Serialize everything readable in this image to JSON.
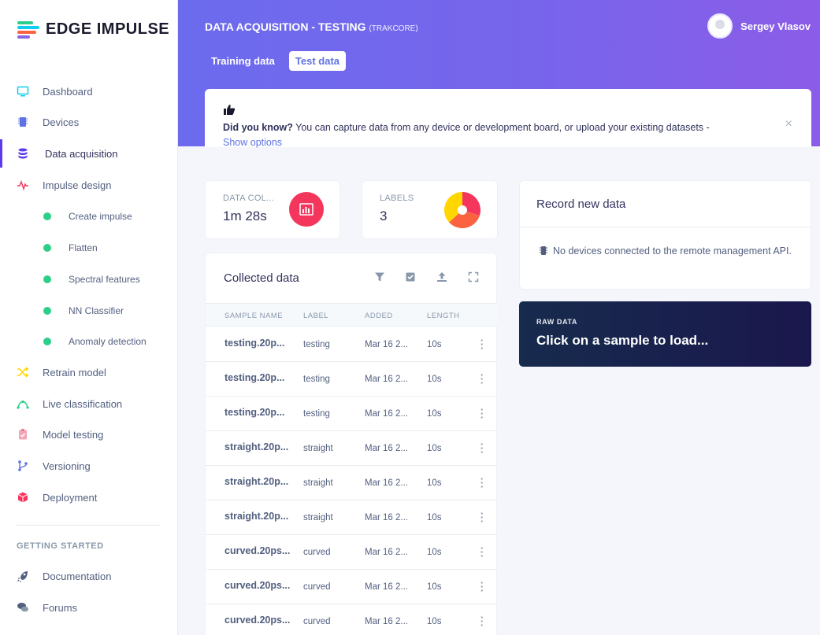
{
  "app": {
    "logo_text": "EDGE IMPULSE"
  },
  "sidebar": {
    "items": [
      {
        "label": "Dashboard",
        "icon": "monitor-icon"
      },
      {
        "label": "Devices",
        "icon": "chip-icon"
      },
      {
        "label": "Data acquisition",
        "icon": "database-icon",
        "active": true
      },
      {
        "label": "Impulse design",
        "icon": "pulse-icon"
      }
    ],
    "subitems": [
      {
        "label": "Create impulse"
      },
      {
        "label": "Flatten"
      },
      {
        "label": "Spectral features"
      },
      {
        "label": "NN Classifier"
      },
      {
        "label": "Anomaly detection"
      }
    ],
    "items2": [
      {
        "label": "Retrain model",
        "icon": "shuffle-icon"
      },
      {
        "label": "Live classification",
        "icon": "signal-icon"
      },
      {
        "label": "Model testing",
        "icon": "clipboard-check-icon"
      },
      {
        "label": "Versioning",
        "icon": "git-branch-icon"
      },
      {
        "label": "Deployment",
        "icon": "package-icon"
      }
    ],
    "getting_started_heading": "GETTING STARTED",
    "help_items": [
      {
        "label": "Documentation",
        "icon": "rocket-icon"
      },
      {
        "label": "Forums",
        "icon": "chat-icon"
      }
    ]
  },
  "header": {
    "title": "DATA ACQUISITION - TESTING",
    "project": "(TRAKCORE)",
    "user_name": "Sergey Vlasov",
    "tabs": [
      {
        "label": "Training data",
        "active": false
      },
      {
        "label": "Test data",
        "active": true
      }
    ]
  },
  "info": {
    "bold": "Did you know?",
    "text": " You can capture data from any device or development board, or upload your existing datasets -",
    "link": "Show options",
    "close": "×"
  },
  "stats": {
    "data_collected_label": "DATA COL...",
    "data_collected_value": "1m 28s",
    "labels_label": "LABELS",
    "labels_value": "3"
  },
  "collected": {
    "title": "Collected data",
    "columns": [
      "SAMPLE NAME",
      "LABEL",
      "ADDED",
      "LENGTH"
    ],
    "rows": [
      {
        "name": "testing.20p...",
        "label": "testing",
        "added": "Mar 16 2...",
        "length": "10s"
      },
      {
        "name": "testing.20p...",
        "label": "testing",
        "added": "Mar 16 2...",
        "length": "10s"
      },
      {
        "name": "testing.20p...",
        "label": "testing",
        "added": "Mar 16 2...",
        "length": "10s"
      },
      {
        "name": "straight.20p...",
        "label": "straight",
        "added": "Mar 16 2...",
        "length": "10s"
      },
      {
        "name": "straight.20p...",
        "label": "straight",
        "added": "Mar 16 2...",
        "length": "10s"
      },
      {
        "name": "straight.20p...",
        "label": "straight",
        "added": "Mar 16 2...",
        "length": "10s"
      },
      {
        "name": "curved.20ps...",
        "label": "curved",
        "added": "Mar 16 2...",
        "length": "10s"
      },
      {
        "name": "curved.20ps...",
        "label": "curved",
        "added": "Mar 16 2...",
        "length": "10s"
      },
      {
        "name": "curved.20ps...",
        "label": "curved",
        "added": "Mar 16 2...",
        "length": "10s"
      }
    ]
  },
  "record": {
    "title": "Record new data",
    "message": "No devices connected to the remote management API."
  },
  "raw": {
    "label": "RAW DATA",
    "text": "Click on a sample to load..."
  },
  "colors": {
    "accent": "#5e72e4",
    "brand_purple": "#5e3aee",
    "stat_red": "#f5365c",
    "pie_yellow": "#ffd600",
    "pie_red": "#f5365c",
    "pie_orange": "#fb6340",
    "success": "#2dce89"
  }
}
